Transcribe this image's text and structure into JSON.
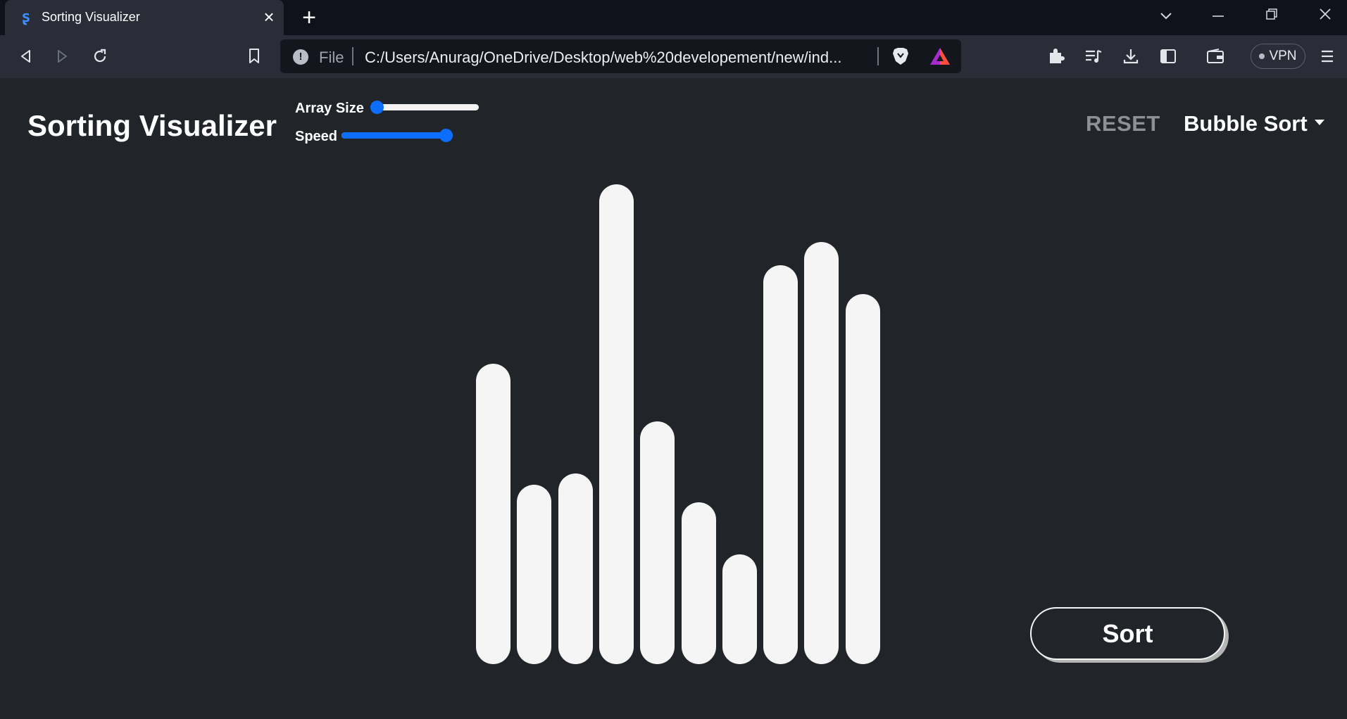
{
  "browser": {
    "tab_title": "Sorting Visualizer",
    "tab_icon": "SV-logo-icon",
    "address_scheme": "File",
    "address_url": "C:/Users/Anurag/OneDrive/Desktop/web%20developement/new/ind...",
    "vpn_label": "VPN"
  },
  "app": {
    "title": "Sorting Visualizer",
    "array_size_label": "Array Size",
    "array_size_level": 0.0,
    "speed_label": "Speed",
    "speed_level": 1.0,
    "reset_label": "RESET",
    "algorithm": "Bubble Sort",
    "sort_label": "Sort",
    "accent_color": "#0d6efd"
  },
  "bars": [
    52,
    31,
    33,
    83,
    42,
    28,
    19,
    69,
    73,
    64
  ]
}
